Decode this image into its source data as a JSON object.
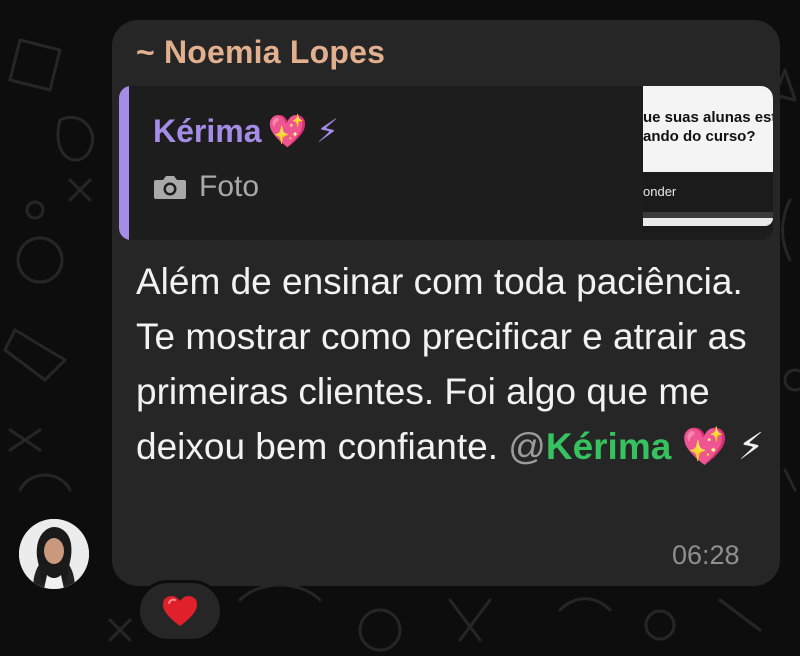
{
  "chat": {
    "sender_name": "~ Noemia Lopes",
    "reply": {
      "author": "Kérima",
      "author_emojis": "💖 ⚡",
      "media_type_icon": "camera-icon",
      "media_type_label": "Foto",
      "thumbnail": {
        "question_line1": "ue suas alunas est",
        "question_line2": "ando do curso?",
        "button_text": "onder"
      }
    },
    "message": {
      "text": "Além de ensinar com toda paciência. Te mostrar como precificar e atrair as primeiras clientes. Foi algo que me deixou bem confiante.",
      "mention_at": "@",
      "mention_name": "Kérima",
      "mention_emojis": "💖 ⚡"
    },
    "time": "06:28",
    "reaction": "❤️"
  },
  "colors": {
    "background": "#0d0d0d",
    "bubble": "#262626",
    "sender_name": "#e3b08f",
    "reply_accent": "#a58ce6",
    "mention": "#36c25f",
    "timestamp": "#8f8f8f"
  }
}
